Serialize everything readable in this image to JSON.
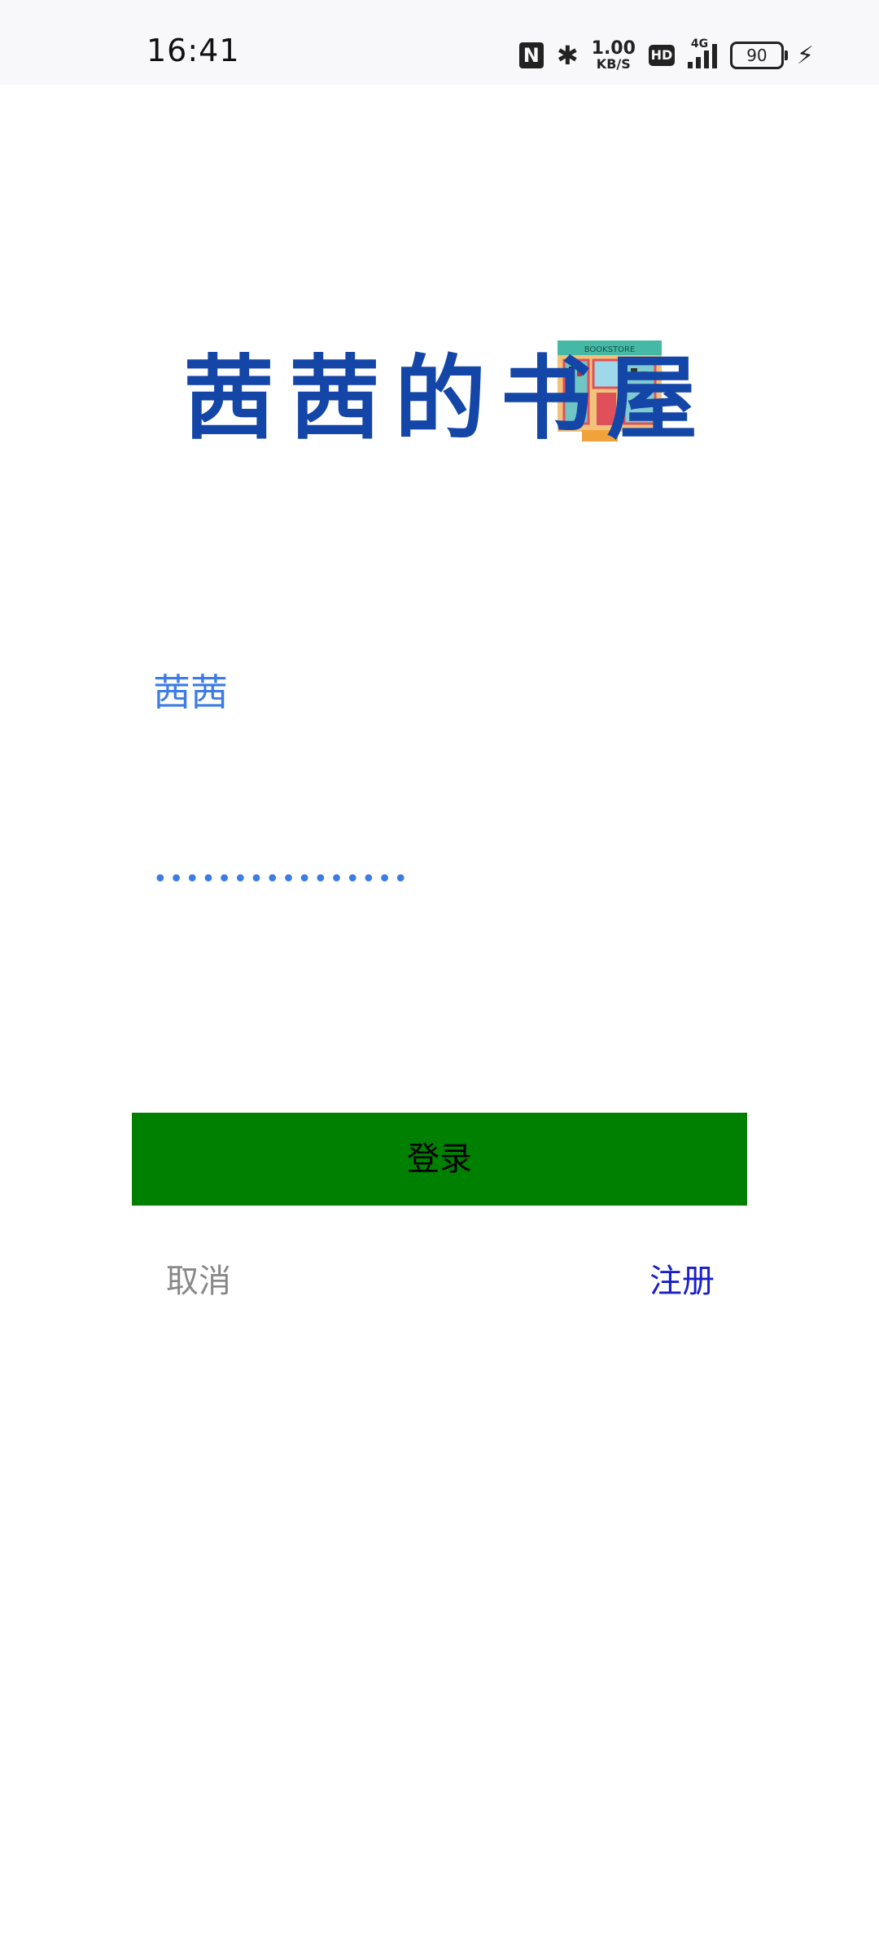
{
  "status_bar": {
    "time": "16:41",
    "net_speed_value": "1.00",
    "net_speed_unit": "KB/S",
    "hd_label": "HD",
    "network_label": "4G",
    "battery_level": "90"
  },
  "logo": {
    "text": "茜茜的书屋",
    "text_color": "#1446a8",
    "sign_text": "BOOKSTORE"
  },
  "form": {
    "username_value": "茜茜",
    "password_value": "••••••••••••••••",
    "login_label": "登录",
    "login_color": "#008000",
    "cancel_label": "取消",
    "register_label": "注册"
  }
}
